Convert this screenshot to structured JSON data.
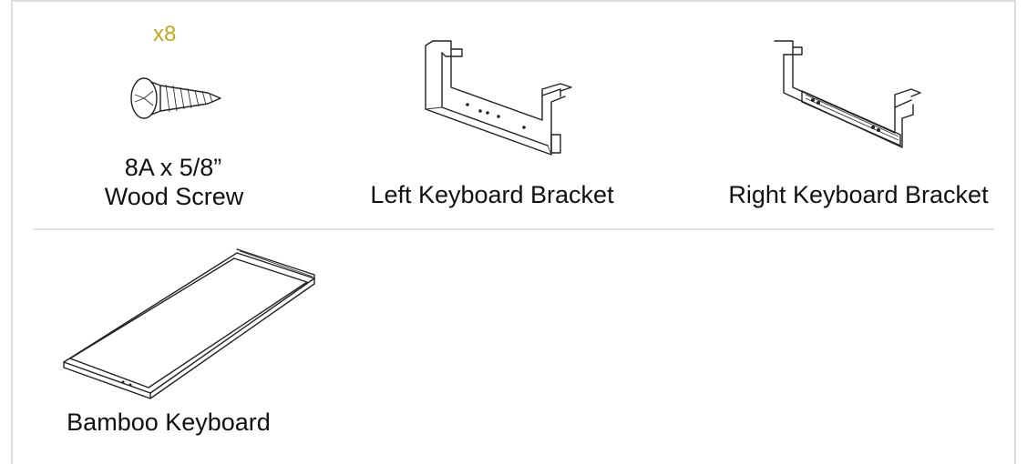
{
  "parts": [
    {
      "name": "8A x 5/8\" Wood Screw",
      "line1": "8A x 5/8”",
      "line2": "Wood Screw",
      "quantity": "x8",
      "icon": "wood-screw-icon"
    },
    {
      "name": "Left Keyboard Bracket",
      "label": "Left Keyboard Bracket",
      "icon": "left-bracket-icon"
    },
    {
      "name": "Right Keyboard Bracket",
      "label": "Right Keyboard Bracket",
      "icon": "right-bracket-icon"
    },
    {
      "name": "Bamboo Keyboard",
      "label": "Bamboo Keyboard",
      "icon": "keyboard-tray-icon"
    }
  ],
  "colors": {
    "quantity": "#c3a61d",
    "divider": "#e2e2e2",
    "frame": "#dcdcdc"
  }
}
